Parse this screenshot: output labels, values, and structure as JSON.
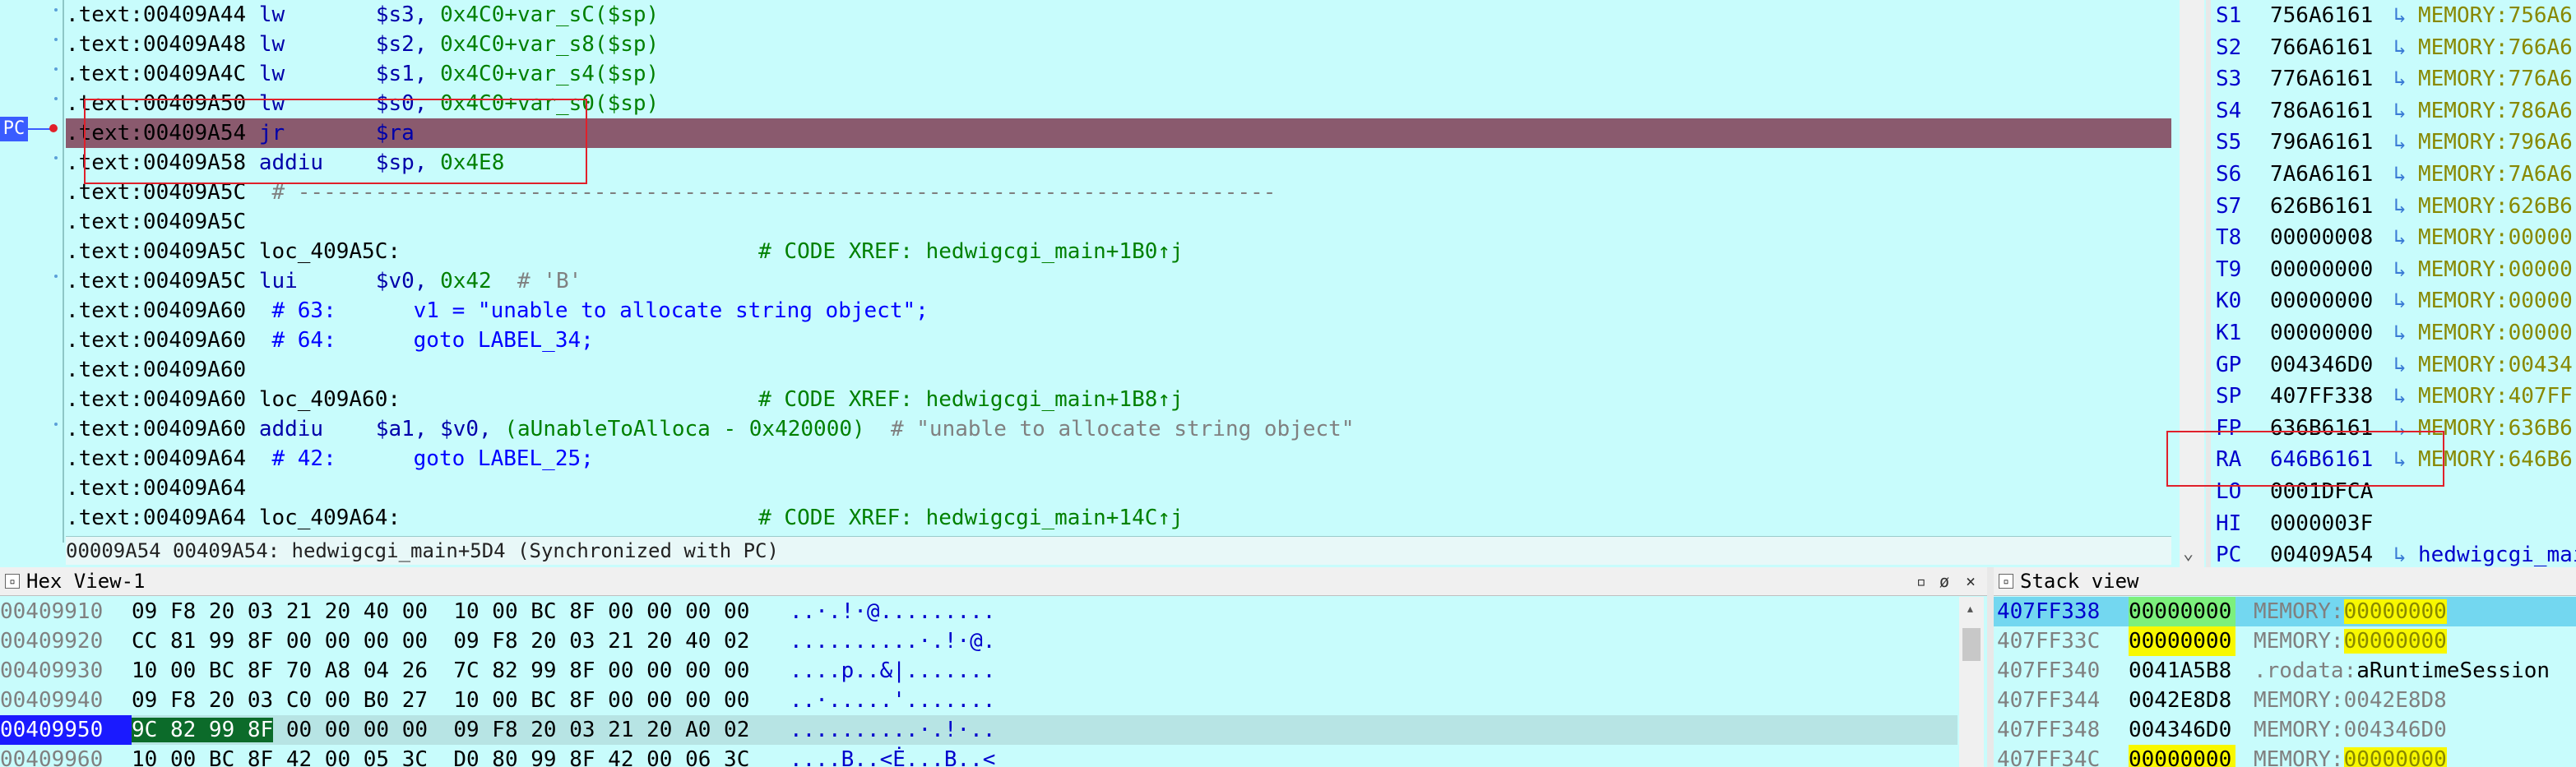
{
  "disasm": {
    "pc_label": "PC",
    "lines": [
      {
        "addr": ".text:00409A44",
        "mnem": "lw",
        "op1": "$s3,",
        "op2": "0x4C0+var_sC($sp)",
        "comment": "",
        "ctype": ""
      },
      {
        "addr": ".text:00409A48",
        "mnem": "lw",
        "op1": "$s2,",
        "op2": "0x4C0+var_s8($sp)",
        "comment": "",
        "ctype": ""
      },
      {
        "addr": ".text:00409A4C",
        "mnem": "lw",
        "op1": "$s1,",
        "op2": "0x4C0+var_s4($sp)",
        "comment": "",
        "ctype": ""
      },
      {
        "addr": ".text:00409A50",
        "mnem": "lw",
        "op1": "$s0,",
        "op2": "0x4C0+var_s0($sp)",
        "comment": "",
        "ctype": ""
      },
      {
        "addr": ".text:00409A54",
        "mnem": "jr",
        "op1": "$ra",
        "op2": "",
        "comment": "",
        "ctype": ""
      },
      {
        "addr": ".text:00409A58",
        "mnem": "addiu",
        "op1": "$sp,",
        "op2": "0x4E8",
        "comment": "",
        "ctype": ""
      },
      {
        "addr": ".text:00409A5C",
        "mnem": "",
        "op1": "",
        "op2": "",
        "comment": "# ----------------------------------------------------------------------------",
        "ctype": "gray"
      },
      {
        "addr": ".text:00409A5C",
        "mnem": "",
        "op1": "",
        "op2": "",
        "comment": "",
        "ctype": ""
      },
      {
        "addr": ".text:00409A5C",
        "mnem": "loc_409A5C:",
        "op1": "",
        "op2": "",
        "comment": "# CODE XREF: hedwigcgi_main+1B0↑j",
        "ctype": "xref"
      },
      {
        "addr": ".text:00409A5C",
        "mnem": "lui",
        "op1": "$v0,",
        "op2": "0x42",
        "comment": "# 'B'",
        "ctype": "gray"
      },
      {
        "addr": ".text:00409A60",
        "mnem": "",
        "op1": "",
        "op2": "",
        "comment": "# 63:      v1 = \"unable to allocate string object\";",
        "ctype": "blue"
      },
      {
        "addr": ".text:00409A60",
        "mnem": "",
        "op1": "",
        "op2": "",
        "comment": "# 64:      goto LABEL_34;",
        "ctype": "blue"
      },
      {
        "addr": ".text:00409A60",
        "mnem": "",
        "op1": "",
        "op2": "",
        "comment": "",
        "ctype": ""
      },
      {
        "addr": ".text:00409A60",
        "mnem": "loc_409A60:",
        "op1": "",
        "op2": "",
        "comment": "# CODE XREF: hedwigcgi_main+1B8↑j",
        "ctype": "xref"
      },
      {
        "addr": ".text:00409A60",
        "mnem": "addiu",
        "op1": "$a1, $v0,",
        "op2": "(aUnableToAlloca - 0x420000)",
        "comment": "# \"unable to allocate string object\"",
        "ctype": "gray"
      },
      {
        "addr": ".text:00409A64",
        "mnem": "",
        "op1": "",
        "op2": "",
        "comment": "# 42:      goto LABEL_25;",
        "ctype": "blue"
      },
      {
        "addr": ".text:00409A64",
        "mnem": "",
        "op1": "",
        "op2": "",
        "comment": "",
        "ctype": ""
      },
      {
        "addr": ".text:00409A64",
        "mnem": "loc_409A64:",
        "op1": "",
        "op2": "",
        "comment": "# CODE XREF: hedwigcgi_main+14C↑j",
        "ctype": "xref"
      }
    ],
    "status": "00009A54 00409A54: hedwigcgi_main+5D4 (Synchronized with PC)"
  },
  "registers": [
    {
      "name": "S1",
      "value": "756A6161",
      "target": "MEMORY:756A6"
    },
    {
      "name": "S2",
      "value": "766A6161",
      "target": "MEMORY:766A6"
    },
    {
      "name": "S3",
      "value": "776A6161",
      "target": "MEMORY:776A6"
    },
    {
      "name": "S4",
      "value": "786A6161",
      "target": "MEMORY:786A6"
    },
    {
      "name": "S5",
      "value": "796A6161",
      "target": "MEMORY:796A6"
    },
    {
      "name": "S6",
      "value": "7A6A6161",
      "target": "MEMORY:7A6A6"
    },
    {
      "name": "S7",
      "value": "626B6161",
      "target": "MEMORY:626B6"
    },
    {
      "name": "T8",
      "value": "00000008",
      "target": "MEMORY:00000"
    },
    {
      "name": "T9",
      "value": "00000000",
      "target": "MEMORY:00000"
    },
    {
      "name": "K0",
      "value": "00000000",
      "target": "MEMORY:00000"
    },
    {
      "name": "K1",
      "value": "00000000",
      "target": "MEMORY:00000"
    },
    {
      "name": "GP",
      "value": "004346D0",
      "target": "MEMORY:00434"
    },
    {
      "name": "SP",
      "value": "407FF338",
      "target": "MEMORY:407FF"
    },
    {
      "name": "FP",
      "value": "636B6161",
      "target": "MEMORY:636B6"
    },
    {
      "name": "RA",
      "value": "646B6161",
      "target": "MEMORY:646B6"
    },
    {
      "name": "LO",
      "value": "0001DFCA",
      "target": ""
    },
    {
      "name": "HI",
      "value": "0000003F",
      "target": ""
    },
    {
      "name": "PC",
      "value": "00409A54",
      "target": "hedwigcgi_mai"
    }
  ],
  "hex_view": {
    "title": "Hex View-1",
    "rows": [
      {
        "addr": "00409910",
        "bytes": "09 F8 20 03 21 20 40 00  10 00 BC 8F 00 00 00 00",
        "ascii": "..·.!·@........."
      },
      {
        "addr": "00409920",
        "bytes": "CC 81 99 8F 00 00 00 00  09 F8 20 03 21 20 40 02",
        "ascii": "..........·.!·@."
      },
      {
        "addr": "00409930",
        "bytes": "10 00 BC 8F 70 A8 04 26  7C 82 99 8F 00 00 00 00",
        "ascii": "....p..&|......."
      },
      {
        "addr": "00409940",
        "bytes": "09 F8 20 03 C0 00 B0 27  10 00 BC 8F 00 00 00 00",
        "ascii": "..·.....'......."
      },
      {
        "addr": "00409950",
        "bytes_sel": "9C 82 99 8F",
        "bytes": " 00 00 00 00  09 F8 20 03 21 20 A0 02",
        "ascii": "..........·.!·.."
      },
      {
        "addr": "00409960",
        "bytes": "10 00 BC 8F 42 00 05 3C  D0 80 99 8F 42 00 06 3C",
        "ascii": "....B..<Ė...B..<"
      }
    ]
  },
  "stack_view": {
    "title": "Stack view",
    "rows": [
      {
        "addr": "407FF338",
        "value": "00000000",
        "target_prefix": "MEMORY:",
        "target": "00000000"
      },
      {
        "addr": "407FF33C",
        "value": "00000000",
        "target_prefix": "MEMORY:",
        "target": "00000000"
      },
      {
        "addr": "407FF340",
        "value": "0041A5B8",
        "target_prefix": ".rodata:",
        "target": "aRuntimeSession"
      },
      {
        "addr": "407FF344",
        "value": "0042E8D8",
        "target_prefix": "MEMORY:",
        "target": "0042E8D8"
      },
      {
        "addr": "407FF348",
        "value": "004346D0",
        "target_prefix": "MEMORY:",
        "target": "004346D0"
      },
      {
        "addr": "407FF34C",
        "value": "00000000",
        "target_prefix": "MEMORY:",
        "target": "00000000"
      }
    ]
  },
  "colors": {
    "background": "#c8fcfc",
    "pc_line": "#8a5a6e",
    "annotation_box": "#e0202a",
    "pc_badge": "#3a5cff"
  }
}
